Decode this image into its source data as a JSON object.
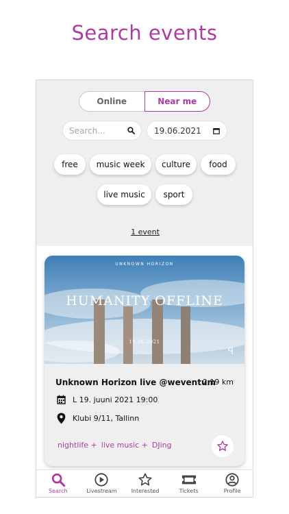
{
  "header": {
    "title": "Search events"
  },
  "filters": {
    "segment": {
      "online": "Online",
      "near": "Near me"
    },
    "search": {
      "placeholder": "Search..."
    },
    "date": "19.06.2021",
    "categories": [
      "free",
      "music week",
      "culture",
      "food",
      "live music",
      "sport"
    ]
  },
  "results": {
    "count": "1 event"
  },
  "event": {
    "image": {
      "brand": "UNKNOWN HORIZON",
      "headline": "HUMANITY OFFLINE",
      "date": "19.06.2021"
    },
    "title": "Unknown Horizon live @weventum",
    "distance": "2.19 km",
    "datetime": "L 19. juuni 2021 19:00",
    "location": "Klubi 9/11, Tallinn",
    "tags": [
      "nightlife +",
      "live music +",
      "DJing"
    ]
  },
  "nav": {
    "items": [
      {
        "label": "Search",
        "icon": "search-icon",
        "active": true
      },
      {
        "label": "Livestream",
        "icon": "play-circle-icon",
        "active": false
      },
      {
        "label": "Interested",
        "icon": "star-icon",
        "active": false
      },
      {
        "label": "Tickets",
        "icon": "ticket-icon",
        "active": false
      },
      {
        "label": "Profile",
        "icon": "profile-icon",
        "active": false
      }
    ]
  },
  "colors": {
    "accent": "#b03aa3",
    "background": "#efefef"
  }
}
